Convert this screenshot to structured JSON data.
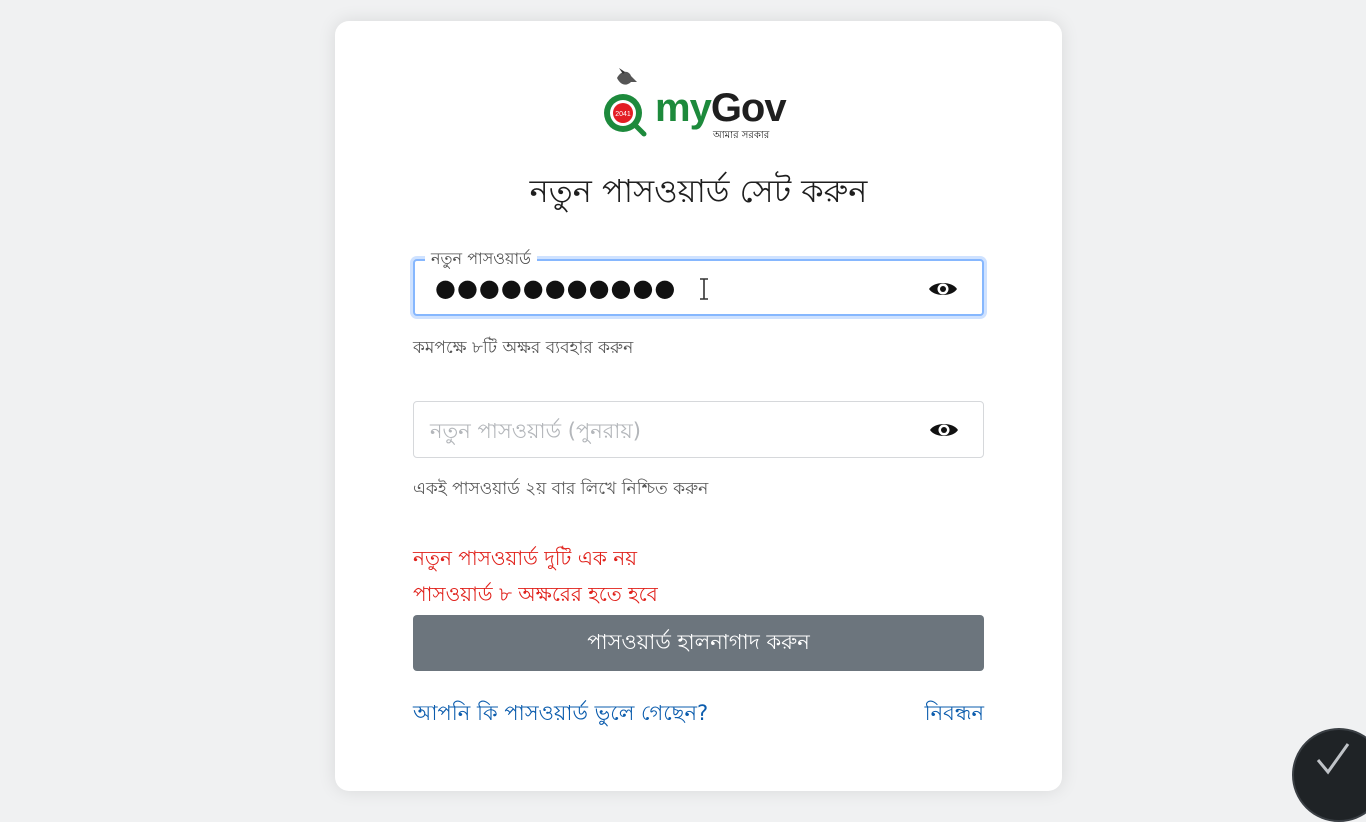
{
  "logo": {
    "word_my": "my",
    "word_gov": "Gov",
    "badge_text": "2041",
    "tagline": "আমার সরকার",
    "brand_green": "#1d8a3c",
    "brand_red": "#e31e24"
  },
  "title": "নতুন পাসওয়ার্ড সেট করুন",
  "new_password": {
    "label": "নতুন পাসওয়ার্ড",
    "value": "●●●●●●●●●●●",
    "help": "কমপক্ষে ৮টি অক্ষর ব্যবহার করুন"
  },
  "confirm_password": {
    "placeholder": "নতুন পাসওয়ার্ড (পুনরায়)",
    "help": "একই পাসওয়ার্ড ২য় বার লিখে নিশ্চিত করুন"
  },
  "errors": [
    "নতুন পাসওয়ার্ড দুটি এক নয়",
    "পাসওয়ার্ড ৮ অক্ষরের হতে হবে"
  ],
  "submit_label": "পাসওয়ার্ড হালনাগাদ করুন",
  "links": {
    "forgot": "আপনি কি পাসওয়ার্ড ভুলে গেছেন?",
    "register": "নিবন্ধন"
  },
  "colors": {
    "error": "#e0211b",
    "link": "#0b5cad",
    "button": "#6c757d",
    "focus": "#86b7fe"
  }
}
